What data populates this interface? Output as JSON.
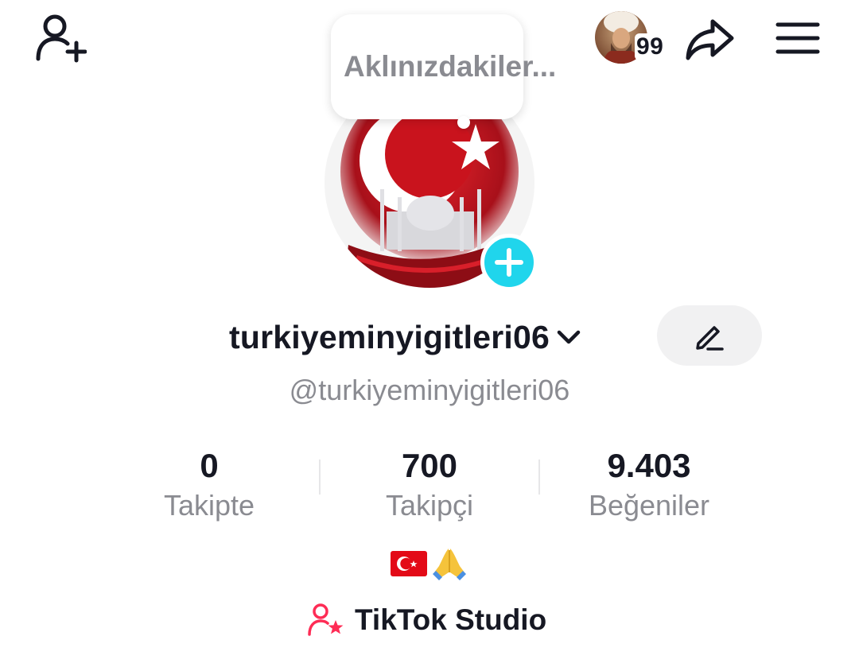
{
  "header": {
    "add_friend_icon": "add-user-icon",
    "story_badge_count": "99",
    "share_icon": "share-arrow-icon",
    "menu_icon": "hamburger-menu-icon"
  },
  "note": {
    "placeholder": "Aklınızdakiler..."
  },
  "profile": {
    "username": "turkiyeminyigitleri06",
    "handle": "@turkiyeminyigitleri06",
    "edit_icon": "pencil-icon",
    "bio_emojis": [
      "turkey-flag",
      "folded-hands"
    ]
  },
  "stats": [
    {
      "value": "0",
      "label": "Takipte"
    },
    {
      "value": "700",
      "label": "Takipçi"
    },
    {
      "value": "9.403",
      "label": "Beğeniler"
    }
  ],
  "studio": {
    "label": "TikTok Studio",
    "icon": "creator-star-icon"
  },
  "colors": {
    "accent_cyan": "#20d5ec",
    "studio_pink": "#fe2c55",
    "flag_red": "#e30a17",
    "text_primary": "#161823",
    "text_secondary": "#8a8b91"
  }
}
